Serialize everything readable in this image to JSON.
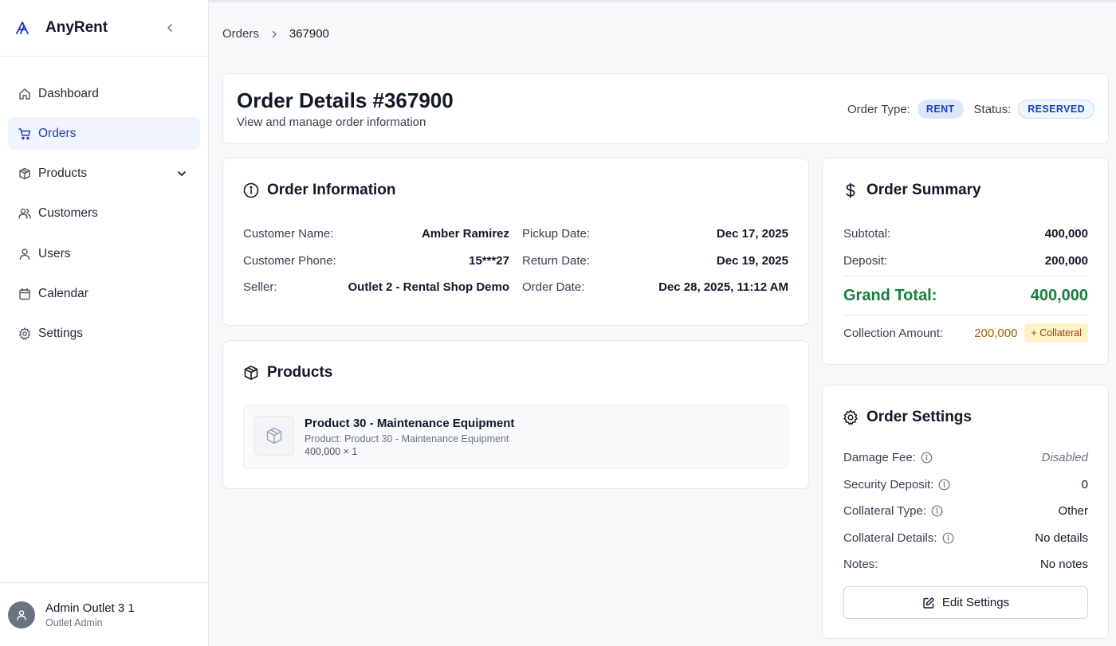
{
  "app": {
    "name": "AnyRent"
  },
  "sidebar": {
    "items": [
      {
        "label": "Dashboard",
        "icon": "home-icon"
      },
      {
        "label": "Orders",
        "icon": "cart-icon",
        "active": true
      },
      {
        "label": "Products",
        "icon": "box-icon",
        "expandable": true
      },
      {
        "label": "Customers",
        "icon": "users-icon"
      },
      {
        "label": "Users",
        "icon": "user-icon"
      },
      {
        "label": "Calendar",
        "icon": "calendar-icon"
      },
      {
        "label": "Settings",
        "icon": "gear-icon"
      }
    ],
    "user": {
      "name": "Admin Outlet 3 1",
      "role": "Outlet Admin"
    }
  },
  "breadcrumb": {
    "parent": "Orders",
    "current": "367900"
  },
  "header": {
    "title": "Order Details #367900",
    "subtitle": "View and manage order information",
    "order_type_label": "Order Type:",
    "order_type": "RENT",
    "status_label": "Status:",
    "status": "RESERVED"
  },
  "order_info": {
    "title": "Order Information",
    "left": [
      {
        "k": "Customer Name:",
        "v": "Amber Ramirez"
      },
      {
        "k": "Customer Phone:",
        "v": "15***27"
      },
      {
        "k": "Seller:",
        "v": "Outlet 2 - Rental Shop Demo"
      }
    ],
    "right": [
      {
        "k": "Pickup Date:",
        "v": "Dec 17, 2025"
      },
      {
        "k": "Return Date:",
        "v": "Dec 19, 2025"
      },
      {
        "k": "Order Date:",
        "v": "Dec 28, 2025, 11:12 AM"
      }
    ]
  },
  "products": {
    "title": "Products",
    "items": [
      {
        "name": "Product 30 - Maintenance Equipment",
        "sub": "Product: Product 30 - Maintenance Equipment",
        "price": "400,000 × 1"
      }
    ]
  },
  "summary": {
    "title": "Order Summary",
    "subtotal_label": "Subtotal:",
    "subtotal": "400,000",
    "deposit_label": "Deposit:",
    "deposit": "200,000",
    "grand_label": "Grand Total:",
    "grand": "400,000",
    "collection_label": "Collection Amount:",
    "collection": "200,000",
    "collateral_badge": "+ Collateral"
  },
  "settings": {
    "title": "Order Settings",
    "rows": [
      {
        "k": "Damage Fee:",
        "v": "Disabled"
      },
      {
        "k": "Security Deposit:",
        "v": "0"
      },
      {
        "k": "Collateral Type:",
        "v": "Other"
      },
      {
        "k": "Collateral Details:",
        "v": "No details"
      },
      {
        "k": "Notes:",
        "v": "No notes"
      }
    ],
    "edit_label": "Edit Settings"
  },
  "colors": {
    "accent": "#1e40af",
    "active_bg": "#eff4fe",
    "grand_total": "#15803d",
    "collection": "#a16207",
    "collateral_bg": "#fef3c7"
  }
}
